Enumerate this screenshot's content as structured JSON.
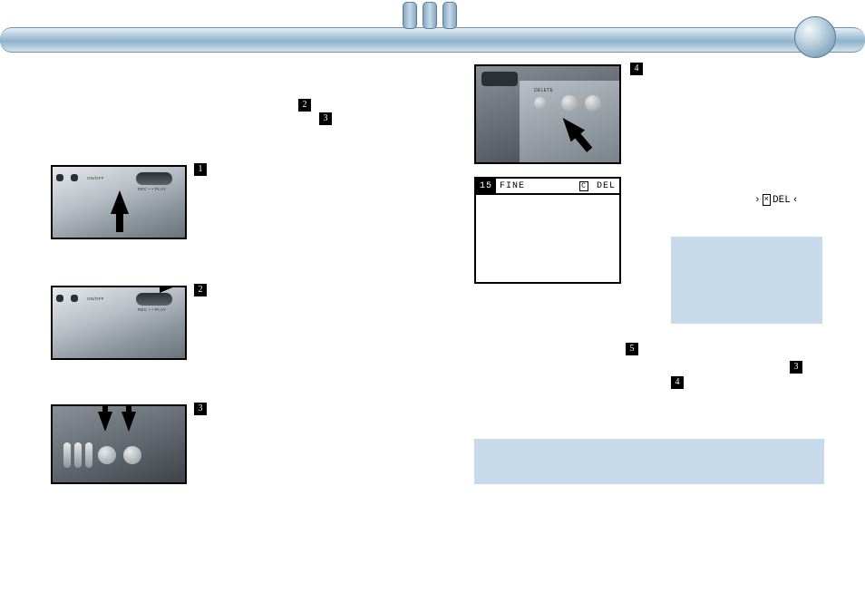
{
  "figures": {
    "f1": {
      "step": "1",
      "onoff": "ON/OFF",
      "recplay": "REC • • PLAY"
    },
    "f2": {
      "step": "2",
      "onoff": "ON/OFF",
      "recplay": "REC • • PLAY"
    },
    "f3": {
      "step": "3"
    },
    "f4": {
      "step": "4",
      "delete": "DELETE"
    }
  },
  "lcd": {
    "frame": "15",
    "quality": "FINE",
    "c": "C",
    "del": "DEL"
  },
  "blink": {
    "box": "×",
    "text": "DEL"
  },
  "inline": {
    "l1": "2",
    "l2": "3",
    "r1": "5",
    "r2": "3",
    "r3": "4"
  }
}
